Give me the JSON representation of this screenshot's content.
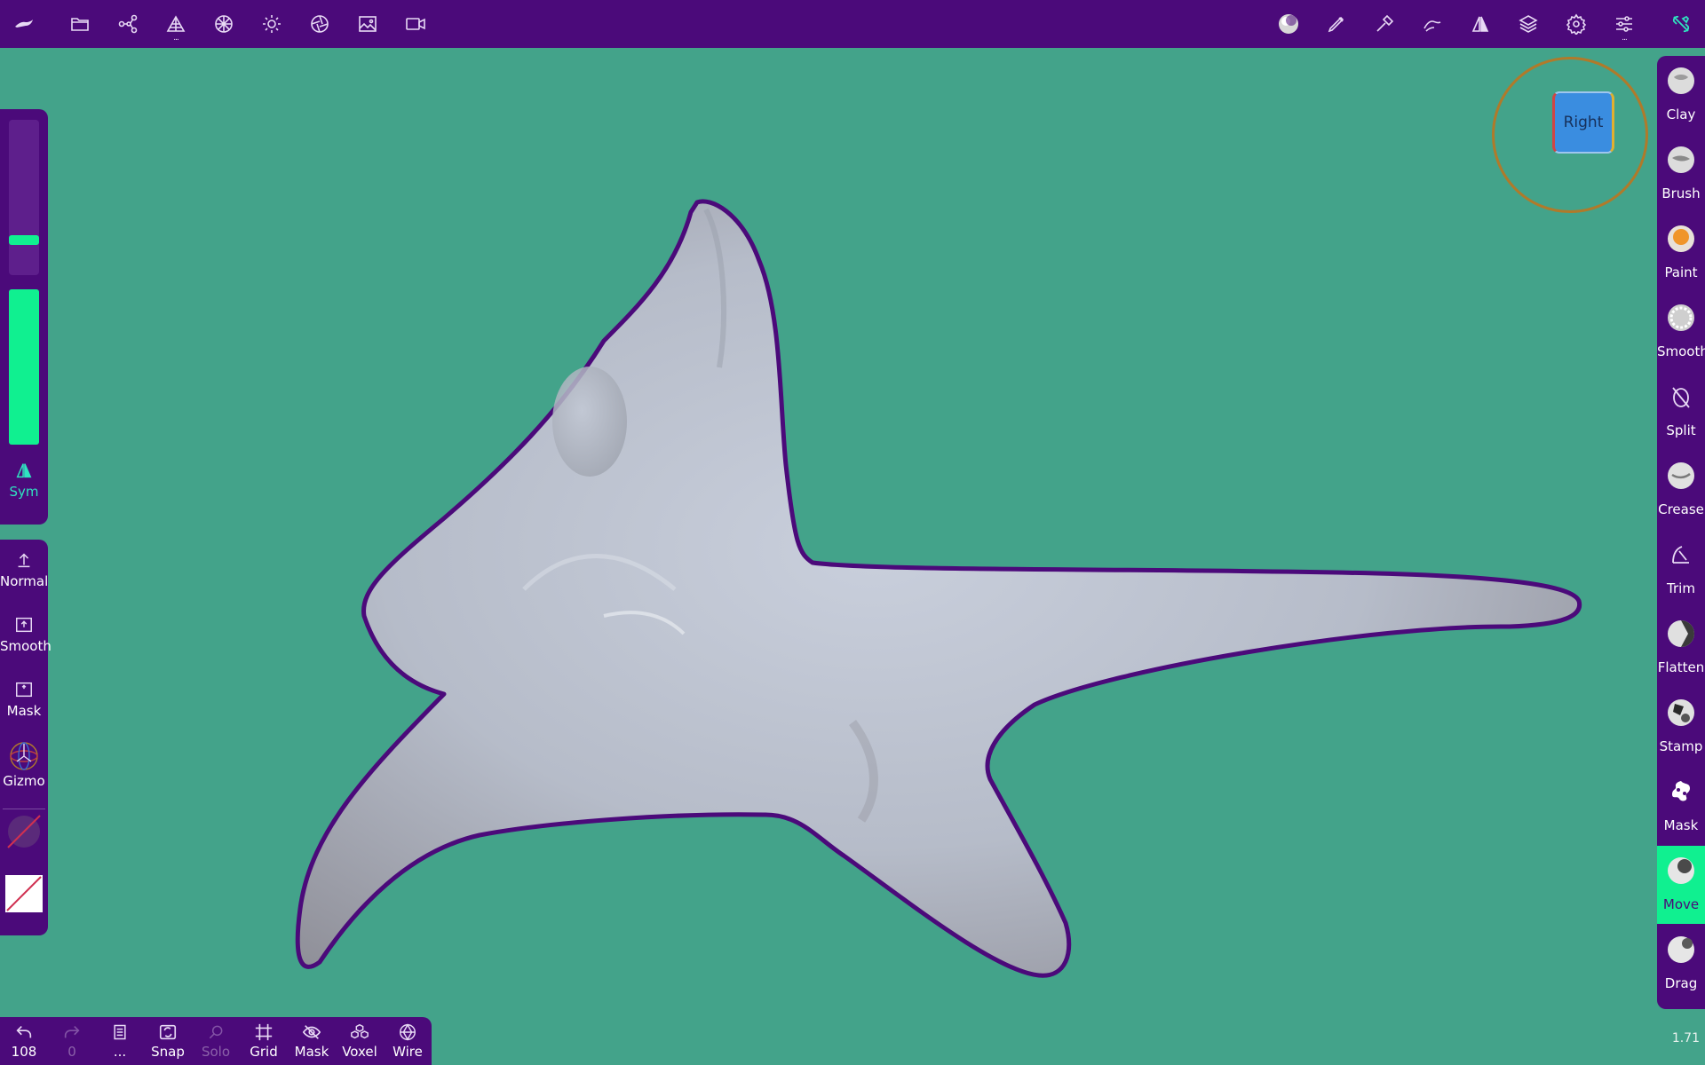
{
  "colors": {
    "bar_bg": "#4b0a7a",
    "viewport_bg": "#43a38a",
    "accent_green": "#10f090",
    "mesh_outline": "#4b0a7a",
    "view_cube": "#3a8de0"
  },
  "top_toolbar": {
    "left_icons": [
      "logo-icon",
      "folder-icon",
      "scene-tree-icon",
      "topology-icon",
      "material-icon",
      "light-icon",
      "aperture-icon",
      "image-icon",
      "video-camera-icon"
    ],
    "right_icons": [
      "matcap-icon",
      "pen-icon",
      "hammer-icon",
      "stroke-icon",
      "symmetry-icon",
      "layers-icon",
      "settings-icon",
      "sliders-icon",
      "tools-icon"
    ]
  },
  "left_panel": {
    "radius_slider_level": 0.06,
    "intensity_slider_level": 1.0,
    "sym_label": "Sym",
    "items": [
      {
        "label": "Normal",
        "icon": "upload-arrow-icon"
      },
      {
        "label": "Smooth",
        "icon": "smooth-box-icon"
      },
      {
        "label": "Mask",
        "icon": "mask-box-icon"
      },
      {
        "label": "Gizmo",
        "icon": "gizmo-icon"
      }
    ]
  },
  "right_tools": [
    {
      "label": "Clay",
      "icon": "clay-icon",
      "active": false
    },
    {
      "label": "Brush",
      "icon": "brush-icon",
      "active": false
    },
    {
      "label": "Paint",
      "icon": "paint-icon",
      "active": false
    },
    {
      "label": "Smooth",
      "icon": "smooth-icon",
      "active": false
    },
    {
      "label": "Split",
      "icon": "split-icon",
      "active": false
    },
    {
      "label": "Crease",
      "icon": "crease-icon",
      "active": false
    },
    {
      "label": "Trim",
      "icon": "trim-icon",
      "active": false
    },
    {
      "label": "Flatten",
      "icon": "flatten-icon",
      "active": false
    },
    {
      "label": "Stamp",
      "icon": "stamp-icon",
      "active": false
    },
    {
      "label": "Mask",
      "icon": "mask-icon",
      "active": false
    },
    {
      "label": "Move",
      "icon": "move-icon",
      "active": true
    },
    {
      "label": "Drag",
      "icon": "drag-icon",
      "active": false
    }
  ],
  "bottom_bar": {
    "undo_count": "108",
    "redo_count": "0",
    "more": "...",
    "items": [
      "Snap",
      "Solo",
      "Grid",
      "Mask",
      "Voxel",
      "Wire"
    ]
  },
  "view_cube": {
    "label": "Right"
  },
  "zoom_readout": "1.71"
}
